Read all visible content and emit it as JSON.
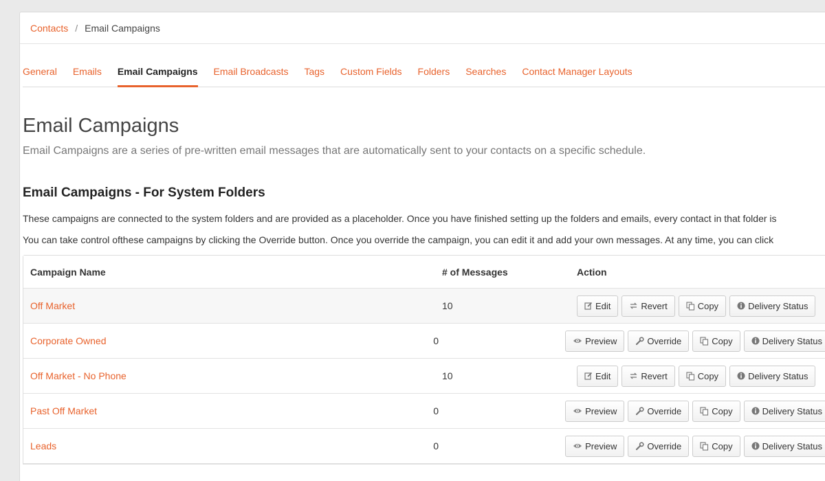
{
  "breadcrumb": {
    "parent": "Contacts",
    "separator": "/",
    "current": "Email Campaigns"
  },
  "tabs": [
    {
      "label": "General",
      "active": false
    },
    {
      "label": "Emails",
      "active": false
    },
    {
      "label": "Email Campaigns",
      "active": true
    },
    {
      "label": "Email Broadcasts",
      "active": false
    },
    {
      "label": "Tags",
      "active": false
    },
    {
      "label": "Custom Fields",
      "active": false
    },
    {
      "label": "Folders",
      "active": false
    },
    {
      "label": "Searches",
      "active": false
    },
    {
      "label": "Contact Manager Layouts",
      "active": false
    }
  ],
  "page": {
    "title": "Email Campaigns",
    "description": "Email Campaigns are a series of pre-written email messages that are automatically sent to your contacts on a specific schedule."
  },
  "section": {
    "title": "Email Campaigns - For System Folders",
    "para1": "These campaigns are connected to the system folders and are provided as a placeholder. Once you have finished setting up the folders and emails, every contact in that folder is",
    "para2": "You can take control ofthese campaigns by clicking the Override button. Once you override the campaign, you can edit it and add your own messages. At any time, you can click"
  },
  "table": {
    "headers": {
      "name": "Campaign Name",
      "messages": "# of Messages",
      "action": "Action"
    },
    "rows": [
      {
        "name": "Off Market",
        "messages": "10",
        "actions": [
          {
            "label": "Edit",
            "icon": "edit-icon"
          },
          {
            "label": "Revert",
            "icon": "revert-icon"
          },
          {
            "label": "Copy",
            "icon": "copy-icon"
          },
          {
            "label": "Delivery Status",
            "icon": "info-icon"
          }
        ]
      },
      {
        "name": "Corporate Owned",
        "messages": "0",
        "actions": [
          {
            "label": "Preview",
            "icon": "eye-icon"
          },
          {
            "label": "Override",
            "icon": "wrench-icon"
          },
          {
            "label": "Copy",
            "icon": "copy-icon"
          },
          {
            "label": "Delivery Status",
            "icon": "info-icon"
          }
        ]
      },
      {
        "name": "Off Market - No Phone",
        "messages": "10",
        "actions": [
          {
            "label": "Edit",
            "icon": "edit-icon"
          },
          {
            "label": "Revert",
            "icon": "revert-icon"
          },
          {
            "label": "Copy",
            "icon": "copy-icon"
          },
          {
            "label": "Delivery Status",
            "icon": "info-icon"
          }
        ]
      },
      {
        "name": "Past Off Market",
        "messages": "0",
        "actions": [
          {
            "label": "Preview",
            "icon": "eye-icon"
          },
          {
            "label": "Override",
            "icon": "wrench-icon"
          },
          {
            "label": "Copy",
            "icon": "copy-icon"
          },
          {
            "label": "Delivery Status",
            "icon": "info-icon"
          }
        ]
      },
      {
        "name": "Leads",
        "messages": "0",
        "actions": [
          {
            "label": "Preview",
            "icon": "eye-icon"
          },
          {
            "label": "Override",
            "icon": "wrench-icon"
          },
          {
            "label": "Copy",
            "icon": "copy-icon"
          },
          {
            "label": "Delivery Status",
            "icon": "info-icon"
          }
        ]
      }
    ]
  },
  "colors": {
    "accent": "#e8622c",
    "row_highlight": "#f7f7f7",
    "text": "#333333"
  }
}
